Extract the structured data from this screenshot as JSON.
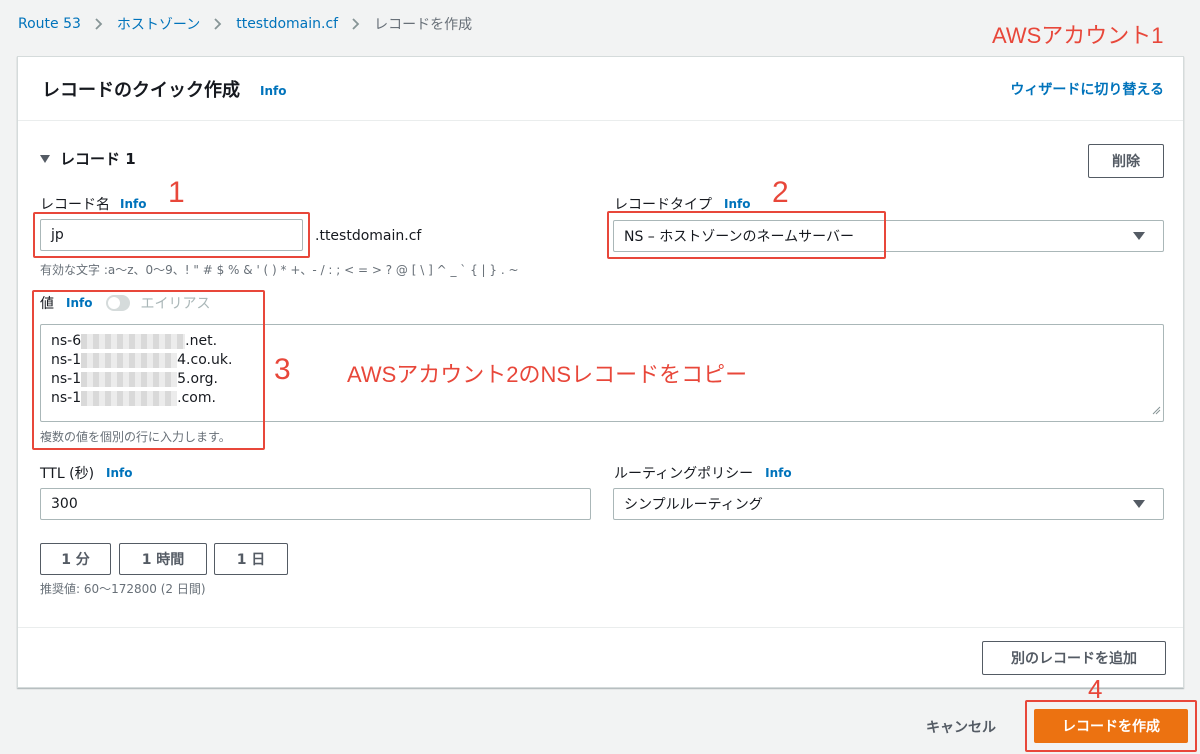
{
  "breadcrumb": {
    "items": [
      "Route 53",
      "ホストゾーン",
      "ttestdomain.cf"
    ],
    "current": "レコードを作成"
  },
  "annotations": {
    "account_label": "AWSアカウント1",
    "step1": "1",
    "step2": "2",
    "step3": "3",
    "step4": "4",
    "copy_note": "AWSアカウント2のNSレコードをコピー"
  },
  "card": {
    "title": "レコードのクイック作成",
    "info": "Info",
    "wizard_link": "ウィザードに切り替える"
  },
  "record": {
    "section_title": "レコード 1",
    "delete_label": "削除",
    "name_label": "レコード名",
    "name_value": "jp",
    "domain_suffix": ".ttestdomain.cf",
    "name_hint": "有効な文字 :a〜z、0〜9、! \" # $ % & ' ( ) * +、- / : ; < = > ? @ [ \\ ] ^ _ ` { | } . ~",
    "type_label": "レコードタイプ",
    "type_value": "NS – ホストゾーンのネームサーバー",
    "value_label": "値",
    "alias_label": "エイリアス",
    "ns_values": [
      {
        "prefix": "ns-6",
        "suffix": ".net."
      },
      {
        "prefix": "ns-1",
        "suffix": "4.co.uk."
      },
      {
        "prefix": "ns-1",
        "suffix": "5.org."
      },
      {
        "prefix": "ns-1",
        "suffix": ".com."
      }
    ],
    "value_hint": "複数の値を個別の行に入力します。",
    "ttl_label": "TTL (秒)",
    "ttl_value": "300",
    "ttl_buttons": [
      "1 分",
      "1 時間",
      "1 日"
    ],
    "ttl_hint": "推奨値: 60〜172800 (2 日間)",
    "routing_label": "ルーティングポリシー",
    "routing_value": "シンプルルーティング"
  },
  "footer": {
    "add_record": "別のレコードを追加",
    "cancel": "キャンセル",
    "create": "レコードを作成"
  },
  "colors": {
    "accent": "#0073bb",
    "primary": "#ec7211",
    "annotation": "#e8473a"
  }
}
